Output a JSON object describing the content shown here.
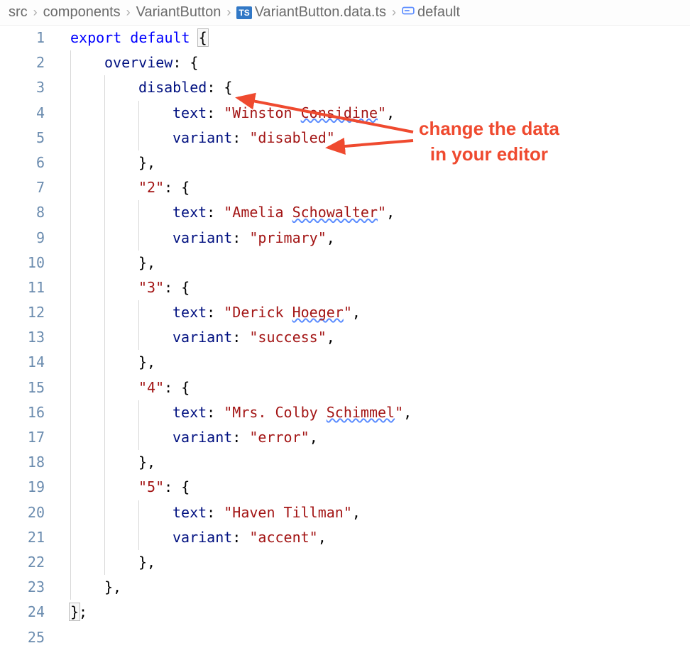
{
  "breadcrumb": {
    "items": [
      "src",
      "components",
      "VariantButton",
      "VariantButton.data.ts",
      "default"
    ]
  },
  "annotation": {
    "line1": "change the data",
    "line2": "in your editor"
  },
  "code": {
    "lines": [
      {
        "n": 1,
        "indent": 0,
        "tokens": [
          {
            "t": "export ",
            "c": "kw-export"
          },
          {
            "t": "default ",
            "c": "kw-default"
          },
          {
            "t": "{",
            "c": "brace bracket-match"
          }
        ]
      },
      {
        "n": 2,
        "indent": 1,
        "tokens": [
          {
            "t": "overview",
            "c": "prop"
          },
          {
            "t": ": {",
            "c": "punct"
          }
        ]
      },
      {
        "n": 3,
        "indent": 2,
        "tokens": [
          {
            "t": "disabled",
            "c": "prop"
          },
          {
            "t": ": {",
            "c": "punct"
          }
        ]
      },
      {
        "n": 4,
        "indent": 3,
        "tokens": [
          {
            "t": "text",
            "c": "prop"
          },
          {
            "t": ": ",
            "c": "punct"
          },
          {
            "t": "\"Winston ",
            "c": "string"
          },
          {
            "t": "Considine",
            "c": "string squiggle"
          },
          {
            "t": "\"",
            "c": "string"
          },
          {
            "t": ",",
            "c": "punct"
          }
        ]
      },
      {
        "n": 5,
        "indent": 3,
        "tokens": [
          {
            "t": "variant",
            "c": "prop"
          },
          {
            "t": ": ",
            "c": "punct"
          },
          {
            "t": "\"disabled\"",
            "c": "string"
          },
          {
            "t": ",",
            "c": "punct"
          }
        ]
      },
      {
        "n": 6,
        "indent": 2,
        "tokens": [
          {
            "t": "},",
            "c": "punct"
          }
        ]
      },
      {
        "n": 7,
        "indent": 2,
        "tokens": [
          {
            "t": "\"2\"",
            "c": "string"
          },
          {
            "t": ": {",
            "c": "punct"
          }
        ]
      },
      {
        "n": 8,
        "indent": 3,
        "tokens": [
          {
            "t": "text",
            "c": "prop"
          },
          {
            "t": ": ",
            "c": "punct"
          },
          {
            "t": "\"Amelia ",
            "c": "string"
          },
          {
            "t": "Schowalter",
            "c": "string squiggle"
          },
          {
            "t": "\"",
            "c": "string"
          },
          {
            "t": ",",
            "c": "punct"
          }
        ]
      },
      {
        "n": 9,
        "indent": 3,
        "tokens": [
          {
            "t": "variant",
            "c": "prop"
          },
          {
            "t": ": ",
            "c": "punct"
          },
          {
            "t": "\"primary\"",
            "c": "string"
          },
          {
            "t": ",",
            "c": "punct"
          }
        ]
      },
      {
        "n": 10,
        "indent": 2,
        "tokens": [
          {
            "t": "},",
            "c": "punct"
          }
        ]
      },
      {
        "n": 11,
        "indent": 2,
        "tokens": [
          {
            "t": "\"3\"",
            "c": "string"
          },
          {
            "t": ": {",
            "c": "punct"
          }
        ]
      },
      {
        "n": 12,
        "indent": 3,
        "tokens": [
          {
            "t": "text",
            "c": "prop"
          },
          {
            "t": ": ",
            "c": "punct"
          },
          {
            "t": "\"Derick ",
            "c": "string"
          },
          {
            "t": "Hoeger",
            "c": "string squiggle"
          },
          {
            "t": "\"",
            "c": "string"
          },
          {
            "t": ",",
            "c": "punct"
          }
        ]
      },
      {
        "n": 13,
        "indent": 3,
        "tokens": [
          {
            "t": "variant",
            "c": "prop"
          },
          {
            "t": ": ",
            "c": "punct"
          },
          {
            "t": "\"success\"",
            "c": "string"
          },
          {
            "t": ",",
            "c": "punct"
          }
        ]
      },
      {
        "n": 14,
        "indent": 2,
        "tokens": [
          {
            "t": "},",
            "c": "punct"
          }
        ]
      },
      {
        "n": 15,
        "indent": 2,
        "tokens": [
          {
            "t": "\"4\"",
            "c": "string"
          },
          {
            "t": ": {",
            "c": "punct"
          }
        ]
      },
      {
        "n": 16,
        "indent": 3,
        "tokens": [
          {
            "t": "text",
            "c": "prop"
          },
          {
            "t": ": ",
            "c": "punct"
          },
          {
            "t": "\"Mrs. Colby ",
            "c": "string"
          },
          {
            "t": "Schimmel",
            "c": "string squiggle"
          },
          {
            "t": "\"",
            "c": "string"
          },
          {
            "t": ",",
            "c": "punct"
          }
        ]
      },
      {
        "n": 17,
        "indent": 3,
        "tokens": [
          {
            "t": "variant",
            "c": "prop"
          },
          {
            "t": ": ",
            "c": "punct"
          },
          {
            "t": "\"error\"",
            "c": "string"
          },
          {
            "t": ",",
            "c": "punct"
          }
        ]
      },
      {
        "n": 18,
        "indent": 2,
        "tokens": [
          {
            "t": "},",
            "c": "punct"
          }
        ]
      },
      {
        "n": 19,
        "indent": 2,
        "tokens": [
          {
            "t": "\"5\"",
            "c": "string"
          },
          {
            "t": ": {",
            "c": "punct"
          }
        ]
      },
      {
        "n": 20,
        "indent": 3,
        "tokens": [
          {
            "t": "text",
            "c": "prop"
          },
          {
            "t": ": ",
            "c": "punct"
          },
          {
            "t": "\"Haven Tillman\"",
            "c": "string"
          },
          {
            "t": ",",
            "c": "punct"
          }
        ]
      },
      {
        "n": 21,
        "indent": 3,
        "tokens": [
          {
            "t": "variant",
            "c": "prop"
          },
          {
            "t": ": ",
            "c": "punct"
          },
          {
            "t": "\"accent\"",
            "c": "string"
          },
          {
            "t": ",",
            "c": "punct"
          }
        ]
      },
      {
        "n": 22,
        "indent": 2,
        "tokens": [
          {
            "t": "},",
            "c": "punct"
          }
        ]
      },
      {
        "n": 23,
        "indent": 1,
        "tokens": [
          {
            "t": "},",
            "c": "punct"
          }
        ]
      },
      {
        "n": 24,
        "indent": 0,
        "tokens": [
          {
            "t": "}",
            "c": "brace bracket-match"
          },
          {
            "t": ";",
            "c": "punct"
          }
        ]
      },
      {
        "n": 25,
        "indent": 0,
        "tokens": []
      }
    ]
  }
}
